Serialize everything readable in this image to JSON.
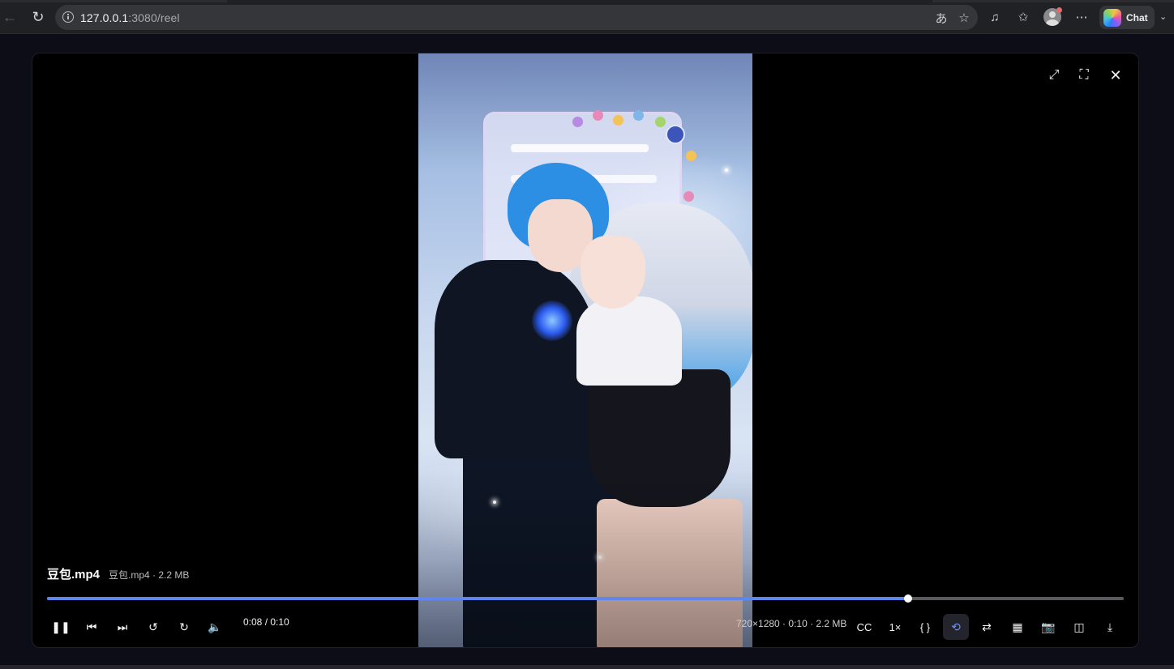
{
  "browser": {
    "address": {
      "host": "127.0.0.1",
      "path": ":3080/reel"
    },
    "chat_label": "Chat"
  },
  "player": {
    "file_title": "豆包.mp4",
    "file_meta": "豆包.mp4 · 2.2 MB",
    "time_display": "0:08 / 0:10",
    "progress_fraction": 0.8,
    "video_info": "720×1280 · 0:10 · 2.2 MB",
    "cc_label": "CC",
    "speed_label": "1×",
    "code_label": "{ }",
    "accent_color": "#5e86ee"
  },
  "icons": {
    "back": "arrow-left-icon",
    "reload": "reload-icon",
    "translate": "translate-icon",
    "favorite": "star-icon",
    "media": "music-note-icon",
    "favorites": "favorites-icon",
    "more": "more-icon",
    "minimize": "minimize-icon",
    "fullscreen": "fullscreen-icon",
    "close": "close-icon",
    "pause": "pause-icon",
    "previous": "skip-previous-icon",
    "next": "skip-next-icon",
    "rewind": "rewind-icon",
    "forward": "forward-icon",
    "volume": "volume-icon",
    "loop": "loop-icon",
    "shuffle": "shuffle-icon",
    "image": "image-icon",
    "camera": "camera-icon",
    "pip": "picture-in-picture-icon",
    "download": "download-icon"
  }
}
